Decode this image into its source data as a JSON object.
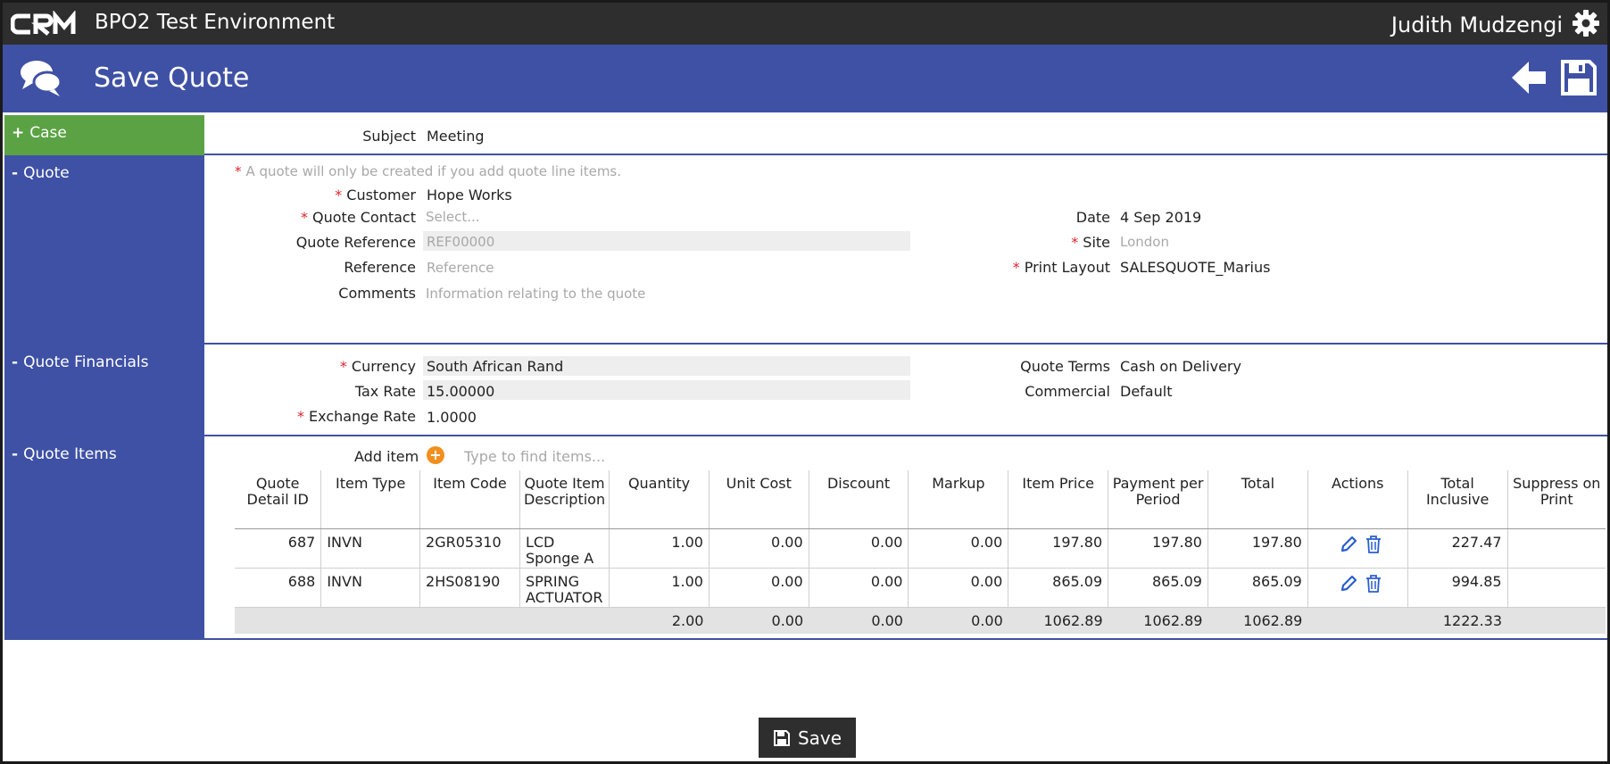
{
  "topbar": {
    "logo_text": "CRM",
    "app_title": "BPO2 Test Environment",
    "user_name": "Judith Mudzengi"
  },
  "titlebar": {
    "title": "Save Quote"
  },
  "sections": {
    "case": {
      "sign": "+",
      "label": "Case"
    },
    "quote": {
      "sign": "-",
      "label": "Quote"
    },
    "financials": {
      "sign": "-",
      "label": "Quote Financials"
    },
    "items": {
      "sign": "-",
      "label": "Quote Items"
    }
  },
  "case": {
    "subject_label": "Subject",
    "subject_value": "Meeting"
  },
  "quote": {
    "note": "A quote will only be created if you add quote line items.",
    "customer_label": "Customer",
    "customer_value": "Hope Works",
    "contact_label": "Quote Contact",
    "contact_placeholder": "Select...",
    "reference_label": "Quote Reference",
    "reference_placeholder": "REF00000",
    "ref_label": "Reference",
    "ref_placeholder": "Reference",
    "comments_label": "Comments",
    "comments_placeholder": "Information relating to the quote",
    "date_label": "Date",
    "date_value": "4 Sep 2019",
    "site_label": "Site",
    "site_placeholder": "London",
    "print_label": "Print Layout",
    "print_value": "SALESQUOTE_Marius"
  },
  "financials": {
    "currency_label": "Currency",
    "currency_value": "South African Rand",
    "tax_label": "Tax Rate",
    "tax_value": "15.00000",
    "exchange_label": "Exchange Rate",
    "exchange_value": "1.0000",
    "terms_label": "Quote Terms",
    "terms_value": "Cash on Delivery",
    "commercial_label": "Commercial",
    "commercial_value": "Default"
  },
  "items": {
    "add_label": "Add item",
    "add_placeholder": "Type to find items...",
    "columns": [
      "Quote Detail ID",
      "Item Type",
      "Item Code",
      "Quote Item Description",
      "Quantity",
      "Unit Cost",
      "Discount",
      "Markup",
      "Item Price",
      "Payment per Period",
      "Total",
      "Actions",
      "Total Inclusive",
      "Suppress on Print"
    ],
    "rows": [
      {
        "id": "687",
        "type": "INVN",
        "code": "2GR05310",
        "desc": "LCD Sponge A",
        "qty": "1.00",
        "unit_cost": "0.00",
        "discount": "0.00",
        "markup": "0.00",
        "item_price": "197.80",
        "payment": "197.80",
        "total": "197.80",
        "total_incl": "227.47",
        "suppress": ""
      },
      {
        "id": "688",
        "type": "INVN",
        "code": "2HS08190",
        "desc": "SPRING ACTUATOR",
        "qty": "1.00",
        "unit_cost": "0.00",
        "discount": "0.00",
        "markup": "0.00",
        "item_price": "865.09",
        "payment": "865.09",
        "total": "865.09",
        "total_incl": "994.85",
        "suppress": ""
      }
    ],
    "totals": {
      "qty": "2.00",
      "unit_cost": "0.00",
      "discount": "0.00",
      "markup": "0.00",
      "item_price": "1062.89",
      "payment": "1062.89",
      "total": "1062.89",
      "total_incl": "1222.33"
    }
  },
  "footer": {
    "save_label": "Save"
  },
  "colors": {
    "header_dark": "#2e2e2e",
    "brand_blue": "#3f51a5",
    "case_green": "#5ba245",
    "required_red": "#d9262c",
    "add_orange": "#f0901e",
    "action_blue": "#2b5fcf"
  },
  "icons": {
    "logo": "crm-logo",
    "settings": "gear-icon",
    "title": "chat-bubbles-icon",
    "back": "arrow-left-icon",
    "save": "floppy-disk-icon",
    "edit": "pencil-icon",
    "delete": "trash-icon",
    "add": "plus-circle-icon"
  }
}
